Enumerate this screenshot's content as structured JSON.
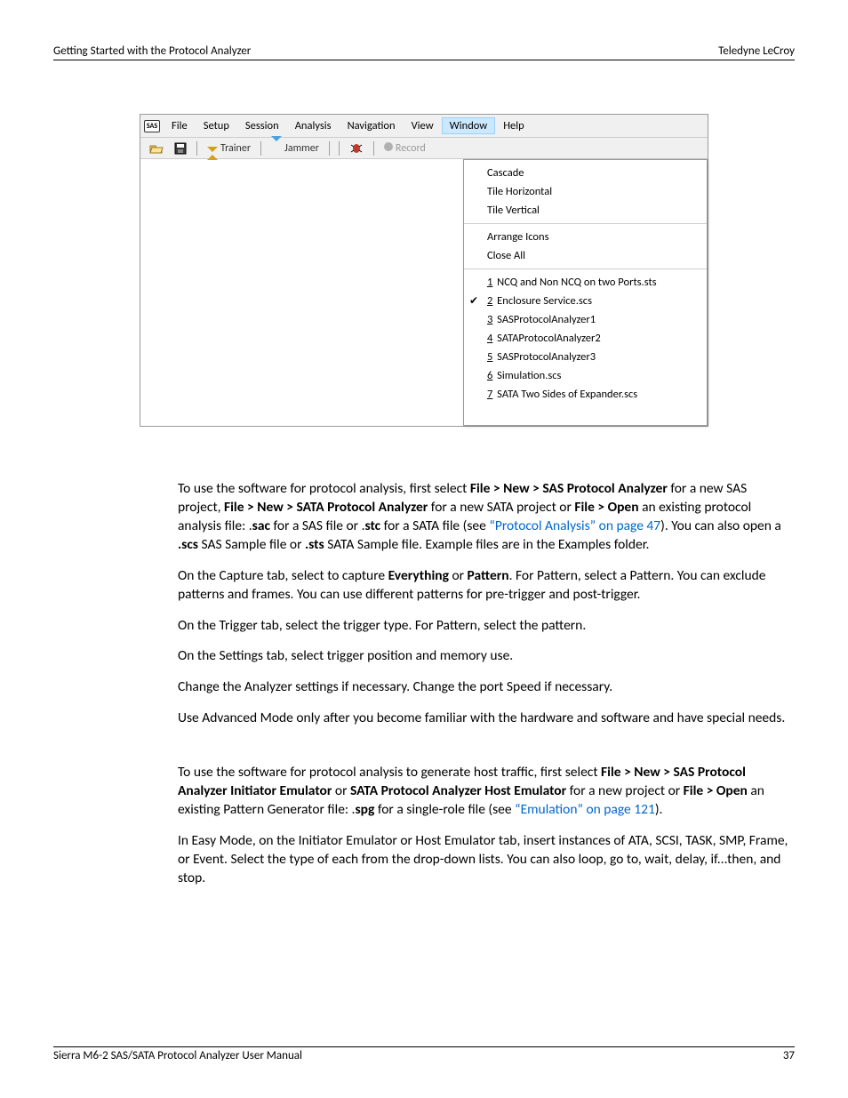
{
  "header": {
    "left": "Getting Started with the Protocol Analyzer",
    "right": "Teledyne LeCroy"
  },
  "footer": {
    "left": "Sierra M6-2 SAS/SATA Protocol Analyzer User Manual",
    "right": "37"
  },
  "menubar": {
    "app_icon_text": "SAS",
    "items": [
      "File",
      "Setup",
      "Session",
      "Analysis",
      "Navigation",
      "View",
      "Window",
      "Help"
    ],
    "selected_index": 6
  },
  "toolbar": {
    "trainer": "Trainer",
    "jammer": "Jammer",
    "record": "Record"
  },
  "dropdown": {
    "group1": [
      "Cascade",
      "Tile Horizontal",
      "Tile Vertical"
    ],
    "group2": [
      "Arrange Icons",
      "Close All"
    ],
    "windows": [
      {
        "num": "1",
        "label": "NCQ and Non NCQ on two Ports.sts",
        "checked": false
      },
      {
        "num": "2",
        "label": "Enclosure Service.scs",
        "checked": true
      },
      {
        "num": "3",
        "label": "SASProtocolAnalyzer1",
        "checked": false
      },
      {
        "num": "4",
        "label": "SATAProtocolAnalyzer2",
        "checked": false
      },
      {
        "num": "5",
        "label": "SASProtocolAnalyzer3",
        "checked": false
      },
      {
        "num": "6",
        "label": "Simulation.scs",
        "checked": false
      },
      {
        "num": "7",
        "label": "SATA Two Sides of Expander.scs",
        "checked": false
      }
    ]
  },
  "body": {
    "p1a": "To use the software for protocol analysis, first select ",
    "p1b": "File > New > SAS Protocol Analyzer",
    "p1c": " for a new SAS project, ",
    "p1d": "File > New > SATA Protocol Analyzer",
    "p1e": " for a new SATA project or ",
    "p1f": "File > Open",
    "p1g": " an existing protocol analysis file: .",
    "p1h": "sac",
    "p1i": " for a SAS file or .",
    "p1j": "stc",
    "p1k": " for a SATA file (see ",
    "p1link": "“Protocol Analysis” on page 47",
    "p1l": "). You can also open a ",
    "p1m": ".scs",
    "p1n": " SAS Sample file or ",
    "p1o": ".sts",
    "p1p": " SATA Sample file. Example files are in the Examples folder.",
    "p2a": "On the Capture tab, select to capture ",
    "p2b": "Everything",
    "p2c": " or ",
    "p2d": "Pattern",
    "p2e": ". For Pattern, select a Pattern. You can exclude patterns and frames. You can use different patterns for pre-trigger and post-trigger.",
    "p3": "On the Trigger tab, select the trigger type. For Pattern, select the pattern.",
    "p4": "On the Settings tab, select trigger position and memory use.",
    "p5": "Change the Analyzer settings if necessary. Change the port Speed if necessary.",
    "p6": "Use Advanced Mode only after you become familiar with the hardware and software and have special needs.",
    "p7a": "To use the software for protocol analysis to generate host traffic, first select ",
    "p7b": "File > New > SAS Protocol Analyzer Initiator Emulator",
    "p7c": " or ",
    "p7d": "SATA Protocol Analyzer Host Emulator",
    "p7e": " for a new project or ",
    "p7f": "File > Open",
    "p7g": " an existing Pattern Generator file: .",
    "p7h": "spg",
    "p7i": " for a single-role file (see ",
    "p7link": "“Emulation” on page 121",
    "p7j": ").",
    "p8": "In Easy Mode, on the Initiator Emulator or Host Emulator tab, insert instances of ATA, SCSI, TASK, SMP, Frame, or Event. Select the type of each from the drop-down lists. You can also loop, go to, wait, delay, if...then, and stop."
  }
}
